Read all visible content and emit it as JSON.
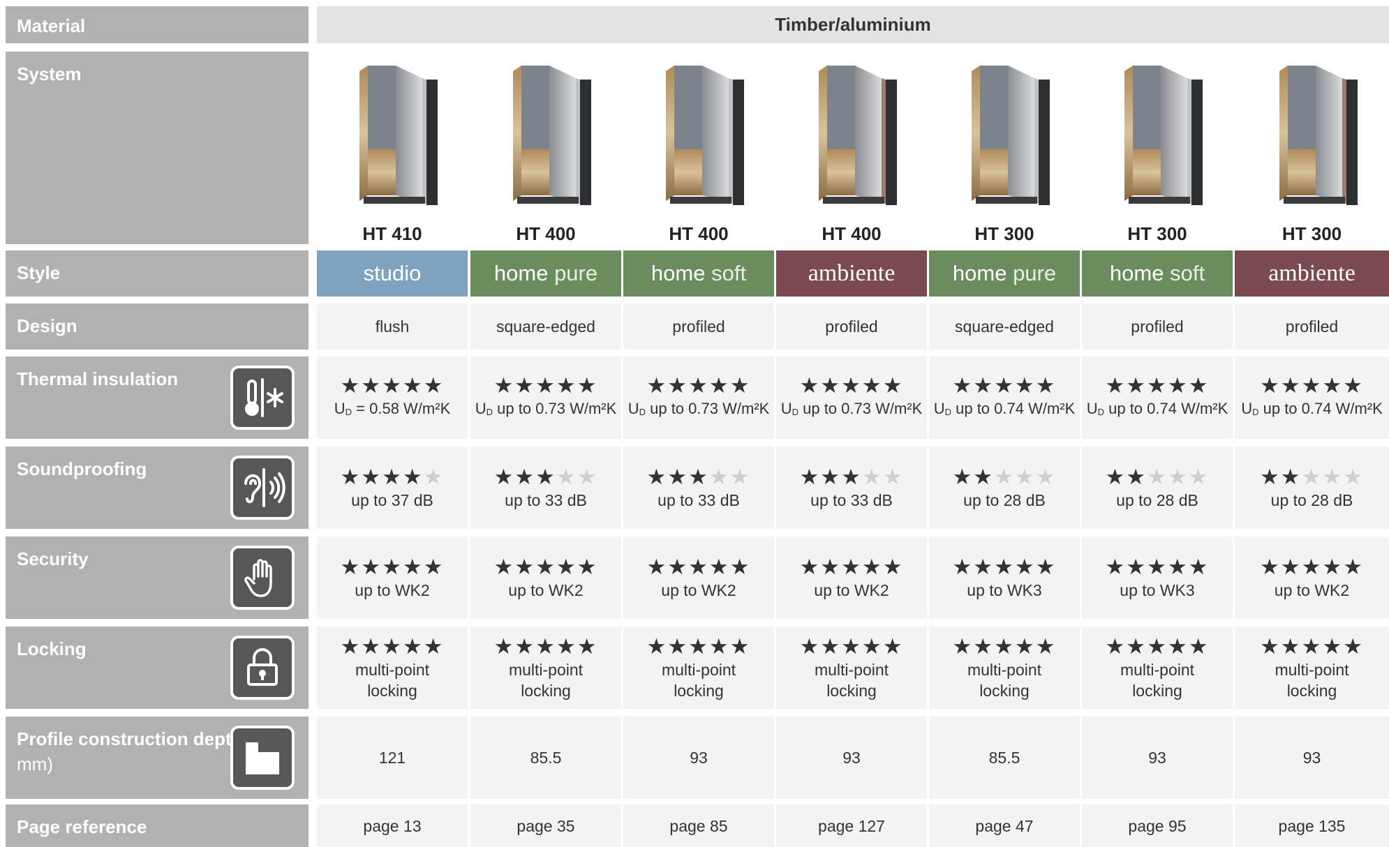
{
  "labels": {
    "material": "Material",
    "system": "System",
    "style": "Style",
    "design": "Design",
    "thermal": "Thermal insulation",
    "sound": "Soundproofing",
    "security": "Security",
    "locking": "Locking",
    "depth": "Profile construction depth",
    "depth_unit": "(in mm)",
    "page": "Page reference"
  },
  "material_value": "Timber/aluminium",
  "icons": {
    "thermal": "thermometer-snowflake-icon",
    "sound": "ear-sound-icon",
    "security": "hand-icon",
    "locking": "padlock-icon",
    "depth": "profile-section-icon"
  },
  "colors": {
    "studio": "#7fa3bf",
    "green": "#6b8c5c",
    "ambiente": "#7b4a50",
    "label_bg": "#b1b1b1",
    "cell_bg": "#f3f3f3",
    "icon_bg": "#575757"
  },
  "u_prefix": "U",
  "u_sub": "D",
  "columns": [
    {
      "model": "HT 410",
      "style_a": "studio",
      "style_b": "",
      "style_color": "#7fa3bf",
      "style_serif": false,
      "design": "flush",
      "thermal_stars": 5,
      "thermal_value": "= 0.58 W/m²K",
      "sound_stars": 4,
      "sound_value": "up to 37 dB",
      "security_stars": 5,
      "security_value": "up to WK2",
      "locking_stars": 5,
      "locking_value_1": "multi-point",
      "locking_value_2": "locking",
      "depth": "121",
      "page": "page 13"
    },
    {
      "model": "HT 400",
      "style_a": "home",
      "style_b": "pure",
      "style_color": "#6b8c5c",
      "style_serif": false,
      "design": "square-edged",
      "thermal_stars": 5,
      "thermal_value": "up to 0.73 W/m²K",
      "sound_stars": 3,
      "sound_value": "up to 33 dB",
      "security_stars": 5,
      "security_value": "up to WK2",
      "locking_stars": 5,
      "locking_value_1": "multi-point",
      "locking_value_2": "locking",
      "depth": "85.5",
      "page": "page 35"
    },
    {
      "model": "HT 400",
      "style_a": "home",
      "style_b": "soft",
      "style_color": "#6b8c5c",
      "style_serif": false,
      "design": "profiled",
      "thermal_stars": 5,
      "thermal_value": "up to 0.73 W/m²K",
      "sound_stars": 3,
      "sound_value": "up to 33 dB",
      "security_stars": 5,
      "security_value": "up to WK2",
      "locking_stars": 5,
      "locking_value_1": "multi-point",
      "locking_value_2": "locking",
      "depth": "93",
      "page": "page 85"
    },
    {
      "model": "HT 400",
      "style_a": "ambiente",
      "style_b": "",
      "style_color": "#7b4a50",
      "style_serif": true,
      "design": "profiled",
      "thermal_stars": 5,
      "thermal_value": "up to 0.73 W/m²K",
      "sound_stars": 3,
      "sound_value": "up to 33 dB",
      "security_stars": 5,
      "security_value": "up to WK2",
      "locking_stars": 5,
      "locking_value_1": "multi-point",
      "locking_value_2": "locking",
      "depth": "93",
      "page": "page 127"
    },
    {
      "model": "HT 300",
      "style_a": "home",
      "style_b": "pure",
      "style_color": "#6b8c5c",
      "style_serif": false,
      "design": "square-edged",
      "thermal_stars": 5,
      "thermal_value": "up to 0.74 W/m²K",
      "sound_stars": 2,
      "sound_value": "up to 28 dB",
      "security_stars": 5,
      "security_value": "up to WK3",
      "locking_stars": 5,
      "locking_value_1": "multi-point",
      "locking_value_2": "locking",
      "depth": "85.5",
      "page": "page 47"
    },
    {
      "model": "HT 300",
      "style_a": "home",
      "style_b": "soft",
      "style_color": "#6b8c5c",
      "style_serif": false,
      "design": "profiled",
      "thermal_stars": 5,
      "thermal_value": "up to 0.74 W/m²K",
      "sound_stars": 2,
      "sound_value": "up to 28 dB",
      "security_stars": 5,
      "security_value": "up to WK3",
      "locking_stars": 5,
      "locking_value_1": "multi-point",
      "locking_value_2": "locking",
      "depth": "93",
      "page": "page 95"
    },
    {
      "model": "HT 300",
      "style_a": "ambiente",
      "style_b": "",
      "style_color": "#7b4a50",
      "style_serif": true,
      "design": "profiled",
      "thermal_stars": 5,
      "thermal_value": "up to 0.74 W/m²K",
      "sound_stars": 2,
      "sound_value": "up to 28 dB",
      "security_stars": 5,
      "security_value": "up to WK2",
      "locking_stars": 5,
      "locking_value_1": "multi-point",
      "locking_value_2": "locking",
      "depth": "93",
      "page": "page 135"
    }
  ]
}
